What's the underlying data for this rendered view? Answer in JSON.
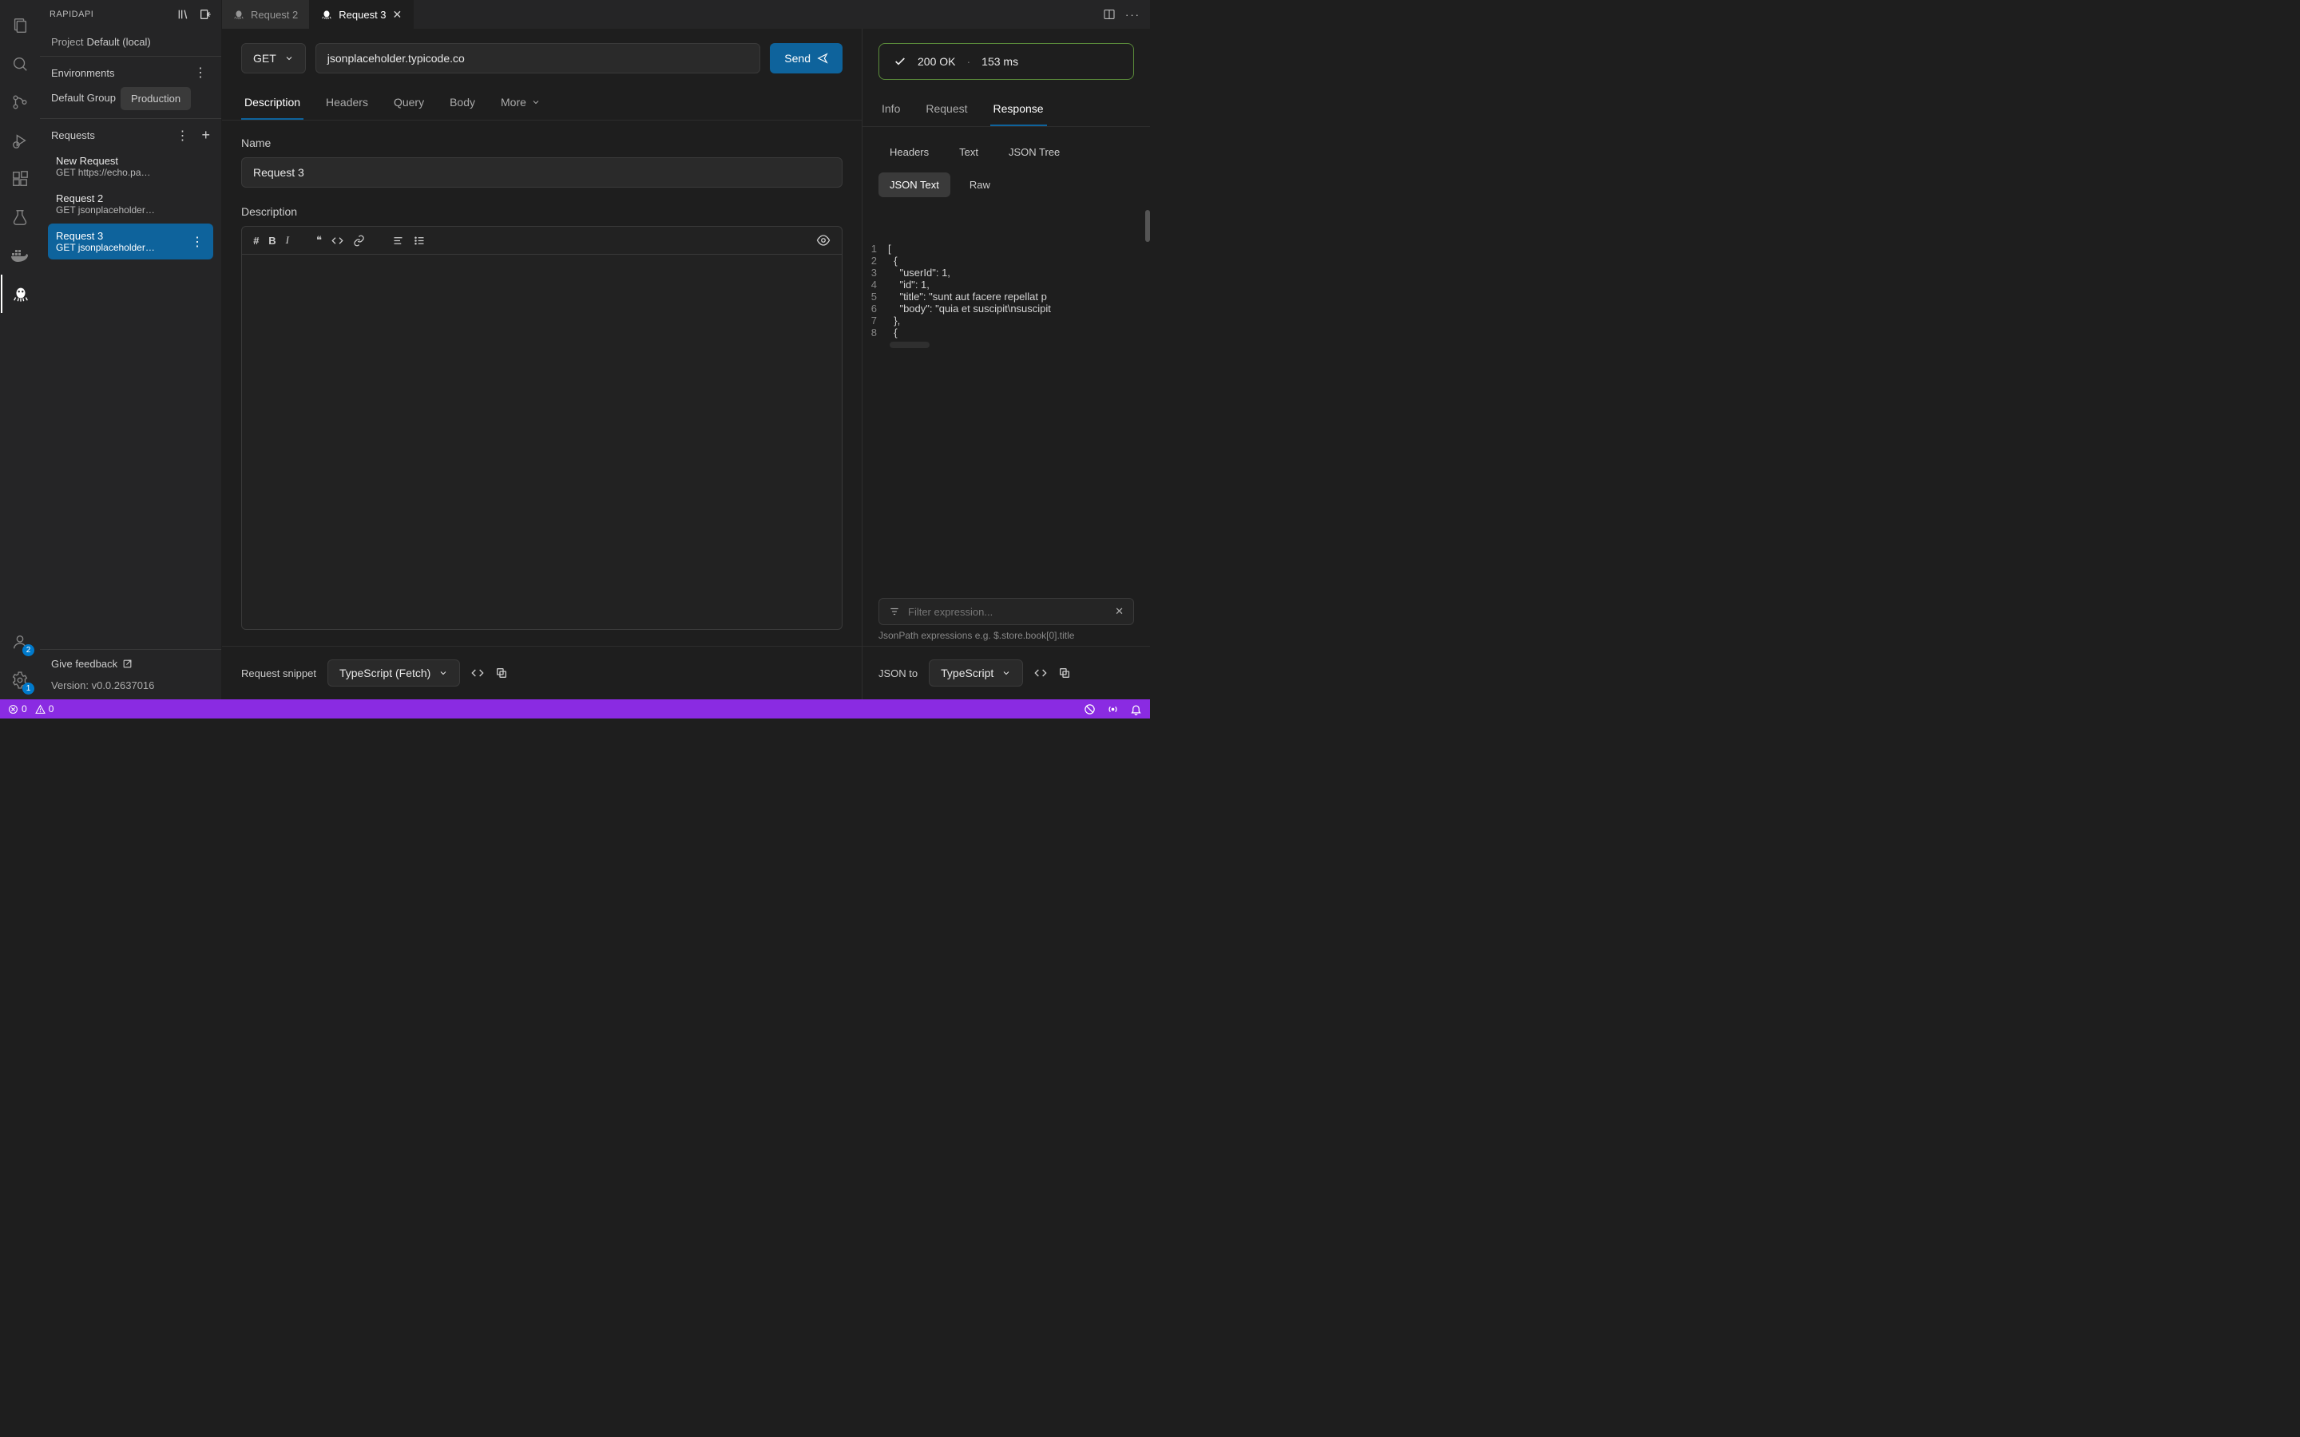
{
  "sidebar": {
    "title": "RAPIDAPI",
    "project_label": "Project",
    "project_value": "Default (local)",
    "env_heading": "Environments",
    "env_group_label": "Default Group",
    "env_selected": "Production",
    "requests_heading": "Requests",
    "requests": [
      {
        "name": "New Request",
        "subtitle": "GET https://echo.pa…"
      },
      {
        "name": "Request 2",
        "subtitle": "GET jsonplaceholder…"
      },
      {
        "name": "Request 3",
        "subtitle": "GET jsonplaceholder…"
      }
    ],
    "feedback": "Give feedback",
    "version_label": "Version: ",
    "version": "v0.0.2637016"
  },
  "activity": {
    "account_badge": "2",
    "settings_badge": "1"
  },
  "tabs": [
    {
      "label": "Request 2"
    },
    {
      "label": "Request 3"
    }
  ],
  "request": {
    "method": "GET",
    "url": "jsonplaceholder.typicode.co",
    "send_label": "Send",
    "tabs": [
      "Description",
      "Headers",
      "Query",
      "Body",
      "More"
    ],
    "name_label": "Name",
    "name_value": "Request 3",
    "desc_label": "Description"
  },
  "snippet": {
    "label": "Request snippet",
    "lang": "TypeScript (Fetch)"
  },
  "response": {
    "status_text": "200 OK",
    "time_text": "153 ms",
    "tabs": [
      "Info",
      "Request",
      "Response"
    ],
    "subtabs": [
      "Headers",
      "Text",
      "JSON Tree",
      "JSON Text",
      "Raw"
    ],
    "filter_placeholder": "Filter expression...",
    "filter_hint": "JsonPath expressions e.g. $.store.book[0].title",
    "json_to_label": "JSON to",
    "json_to_lang": "TypeScript",
    "body_lines": [
      "[",
      "  {",
      "    \"userId\": 1,",
      "    \"id\": 1,",
      "    \"title\": \"sunt aut facere repellat p",
      "    \"body\": \"quia et suscipit\\nsuscipit ",
      "  },",
      "  {"
    ]
  },
  "statusbar": {
    "errors": "0",
    "warnings": "0"
  }
}
